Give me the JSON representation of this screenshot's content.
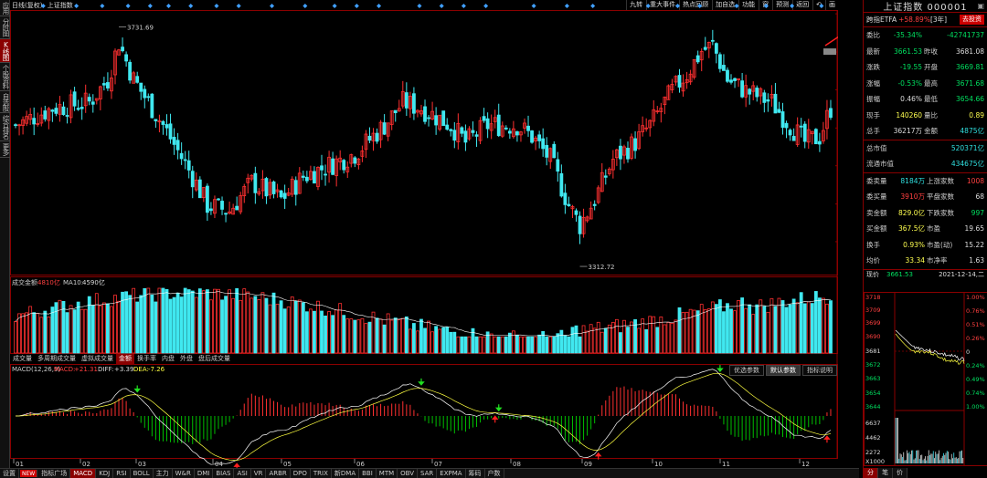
{
  "window": {
    "title_prefix": "日线(复权)",
    "title_name": "上证指数"
  },
  "left_tabs": [
    "应用",
    "分时图",
    "K线图",
    "个股资料",
    "自选股",
    "综合排名",
    "更多"
  ],
  "top_menu": [
    "九转",
    "重大事件",
    "热点回顾",
    "加自选",
    "功能",
    "窗",
    "预测",
    "返回",
    "画"
  ],
  "top_menu_icon": "undo-icon",
  "price_axis": [
    "3755",
    "3688",
    "3622",
    "3555",
    "3489",
    "3422",
    "3356"
  ],
  "price_annotations": {
    "high": "3731.69",
    "low": "3312.72"
  },
  "volume": {
    "title": "成交金额",
    "value": "4810亿",
    "ma_label": "MA10:",
    "ma_value": "4590亿",
    "axis": [
      "842529",
      "561686",
      "280843"
    ]
  },
  "mid_tabs": [
    "成交量",
    "多周期成交量",
    "虚拟成交量",
    "金额",
    "换手率",
    "内盘",
    "外盘",
    "盘后成交量"
  ],
  "mid_active": 3,
  "macd": {
    "params": "MACD(12,26,9)",
    "macd_label": "MACD:",
    "macd_value": "+21.31",
    "diff_label": "DIFF:",
    "diff_value": "+3.39",
    "dea_label": "DEA:",
    "dea_value": "-7.26",
    "axis": [
      "+55.30",
      "+28.46",
      "0",
      "-27.17"
    ],
    "buttons": [
      "优选参数",
      "默认参数",
      "指标说明"
    ]
  },
  "months": [
    "01",
    "02",
    "03",
    "04",
    "05",
    "06",
    "07",
    "08",
    "09",
    "10",
    "11",
    "12"
  ],
  "bottom_tabs": [
    "设置",
    "NEW",
    "指标广场",
    "MACD",
    "KDJ",
    "RSI",
    "BOLL",
    "主力",
    "W&R",
    "DMI",
    "BIAS",
    "ASI",
    "VR",
    "ARBR",
    "DPO",
    "TRIX",
    "新DMA",
    "BBI",
    "MTM",
    "OBV",
    "SAR",
    "EXPMA",
    "筹码",
    "户数"
  ],
  "bottom_active": 3,
  "right_panel": {
    "title": "上证指数 000001",
    "etf_label": "跨指ETFA",
    "etf_value": "+58.89%",
    "etf_period": "[3年]",
    "etf_button": "去投资",
    "rows": [
      {
        "l1": "委比",
        "v1": "-35.34%",
        "c1": "green",
        "l2": "",
        "v2": "-42741737",
        "c2": "green"
      },
      {
        "l1": "最新",
        "v1": "3661.53",
        "c1": "green",
        "l2": "昨收",
        "v2": "3681.08",
        "c2": "wht"
      },
      {
        "l1": "涨跌",
        "v1": "-19.55",
        "c1": "green",
        "l2": "开盘",
        "v2": "3669.81",
        "c2": "green"
      },
      {
        "l1": "涨幅",
        "v1": "-0.53%",
        "c1": "green",
        "l2": "最高",
        "v2": "3671.68",
        "c2": "green"
      },
      {
        "l1": "振幅",
        "v1": "0.46%",
        "c1": "wht",
        "l2": "最低",
        "v2": "3654.66",
        "c2": "green"
      },
      {
        "l1": "现手",
        "v1": "140260",
        "c1": "yel",
        "l2": "量比",
        "v2": "0.89",
        "c2": "yel"
      },
      {
        "l1": "总手",
        "v1": "36217万",
        "c1": "wht",
        "l2": "金额",
        "v2": "4875亿",
        "c2": "cyan"
      }
    ],
    "rows2": [
      {
        "l": "总市值",
        "v": "520371亿",
        "c": "cyan"
      },
      {
        "l": "流通市值",
        "v": "434675亿",
        "c": "cyan"
      }
    ],
    "rows3": [
      {
        "l1": "委卖量",
        "v1": "8184万",
        "c1": "cyan",
        "l2": "上涨家数",
        "v2": "1008",
        "c2": "red"
      },
      {
        "l1": "委买量",
        "v1": "3910万",
        "c1": "red",
        "l2": "平盘家数",
        "v2": "68",
        "c2": "wht"
      },
      {
        "l1": "卖金额",
        "v1": "829.0亿",
        "c1": "yel",
        "l2": "下跌家数",
        "v2": "997",
        "c2": "green"
      },
      {
        "l1": "买金额",
        "v1": "367.5亿",
        "c1": "yel",
        "l2": "市盈",
        "v2": "19.65",
        "c2": "wht"
      },
      {
        "l1": "换手",
        "v1": "0.93%",
        "c1": "yel",
        "l2": "市盈(动)",
        "v2": "15.22",
        "c2": "wht"
      },
      {
        "l1": "均价",
        "v1": "33.34",
        "c1": "yel",
        "l2": "市净率",
        "v2": "1.63",
        "c2": "wht"
      }
    ],
    "mini": {
      "now_label": "现价",
      "now_value": "3661.53",
      "date": "2021-12-14,二",
      "left_axis": [
        "3718",
        "3709",
        "3699",
        "3690",
        "3681",
        "3672",
        "3663",
        "3654",
        "3644",
        "6637",
        "4462",
        "2272",
        "X1000"
      ],
      "right_axis": [
        "1.00%",
        "0.76%",
        "0.51%",
        "0.26%",
        "0",
        "0.24%",
        "0.49%",
        "0.74%",
        "1.00%"
      ]
    },
    "tabs": [
      "分",
      "笔",
      "价"
    ]
  },
  "colors": {
    "up": "#ff3030",
    "down": "#40e8f0",
    "frame": "#8b0000"
  }
}
